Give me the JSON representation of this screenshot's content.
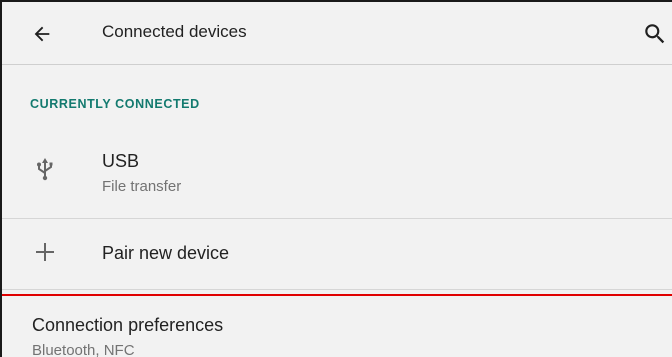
{
  "toolbar": {
    "back_icon": "arrow-back-icon",
    "title": "Connected devices",
    "search_icon": "search-icon"
  },
  "section": {
    "header": "CURRENTLY CONNECTED"
  },
  "items": {
    "usb": {
      "icon": "usb-icon",
      "title": "USB",
      "subtitle": "File transfer"
    },
    "pair": {
      "icon": "plus-icon",
      "title": "Pair new device"
    },
    "connection_preferences": {
      "title": "Connection preferences",
      "subtitle": "Bluetooth, NFC"
    }
  },
  "colors": {
    "accent": "#137a6f",
    "highlight_border": "#e00000",
    "background": "#f2f2f2"
  }
}
